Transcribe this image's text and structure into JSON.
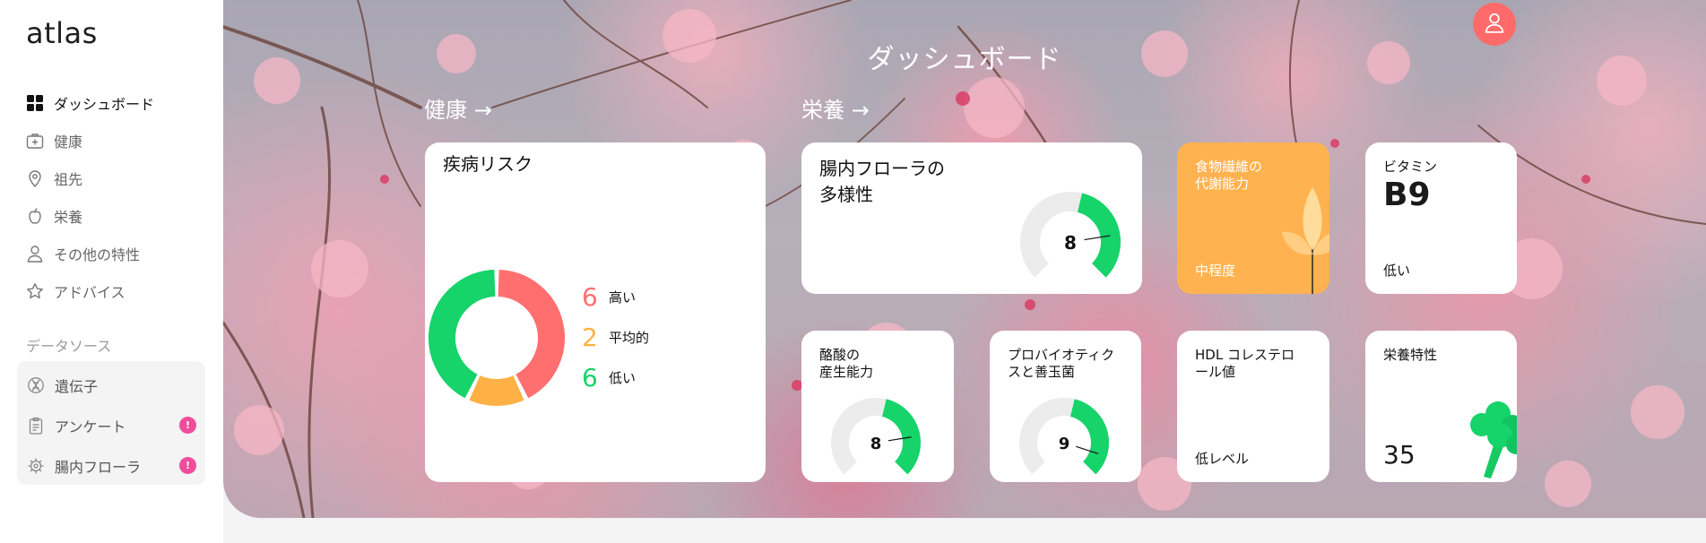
{
  "app": {
    "logo": "atlas"
  },
  "sidebar": {
    "nav": [
      {
        "label": "ダッシュボード",
        "icon": "grid-icon",
        "active": true
      },
      {
        "label": "健康",
        "icon": "medical-kit-icon"
      },
      {
        "label": "祖先",
        "icon": "map-pin-icon"
      },
      {
        "label": "栄養",
        "icon": "apple-icon"
      },
      {
        "label": "その他の特性",
        "icon": "person-icon"
      },
      {
        "label": "アドバイス",
        "icon": "star-icon"
      }
    ],
    "data_sources_title": "データソース",
    "data_sources": [
      {
        "label": "遺伝子",
        "icon": "dna-icon",
        "badge": ""
      },
      {
        "label": "アンケート",
        "icon": "clipboard-icon",
        "badge": "!"
      },
      {
        "label": "腸内フローラ",
        "icon": "bacteria-icon",
        "badge": "!"
      }
    ]
  },
  "header": {
    "title": "ダッシュボード"
  },
  "sections": {
    "health": "健康 →",
    "nutrition": "栄養 →"
  },
  "cards": {
    "disease_risk": {
      "title": "疾病リスク",
      "legend": [
        {
          "count": "6",
          "label": "高い",
          "color": "#ff6f6f"
        },
        {
          "count": "2",
          "label": "平均的",
          "color": "#ffb145"
        },
        {
          "count": "6",
          "label": "低い",
          "color": "#16d36a"
        }
      ]
    },
    "gut_diversity": {
      "title_line1": "腸内フローラの",
      "title_line2": "多様性",
      "score": "8",
      "level": 0.8
    },
    "fiber": {
      "title_line1": "食物繊維の",
      "title_line2": "代謝能力",
      "value": "中程度",
      "bg": "#ffb24f"
    },
    "vitamin": {
      "title": "ビタミン",
      "name": "B9",
      "value": "低い"
    },
    "butyrate": {
      "title_line1": "酪酸の",
      "title_line2": "産生能力",
      "score": "8",
      "level": 0.8
    },
    "probiotics": {
      "title_line1": "プロバイオティク",
      "title_line2": "スと善玉菌",
      "score": "9",
      "level": 0.9
    },
    "hdl": {
      "title_line1": "HDL コレステロ",
      "title_line2": "ール値",
      "value": "低レベル"
    },
    "nutrition_traits": {
      "title": "栄養特性",
      "value": "35"
    }
  },
  "colors": {
    "accent": "#16d36a",
    "danger": "#ff6f6f",
    "warning": "#ffb145",
    "avatar": "#ff6b6b",
    "badge": "#ee4d9b"
  }
}
